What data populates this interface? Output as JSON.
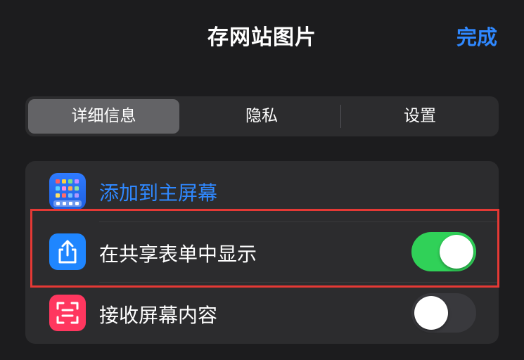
{
  "header": {
    "title": "存网站图片",
    "done_label": "完成"
  },
  "segments": [
    {
      "label": "详细信息",
      "selected": true
    },
    {
      "label": "隐私",
      "selected": false
    },
    {
      "label": "设置",
      "selected": false
    }
  ],
  "settings": {
    "rows": [
      {
        "label": "添加到主屏幕",
        "icon": "home-screen-grid-icon",
        "is_link": true
      },
      {
        "label": "在共享表单中显示",
        "icon": "share-icon",
        "toggle": true
      },
      {
        "label": "接收屏幕内容",
        "icon": "scan-frame-icon",
        "toggle": false
      }
    ]
  },
  "colors": {
    "accent": "#2f88ff",
    "toggle_on": "#30d158",
    "toggle_off": "#39393d",
    "highlight": "#e53935",
    "background": "#1c1c1e",
    "card": "#2c2c2e"
  }
}
